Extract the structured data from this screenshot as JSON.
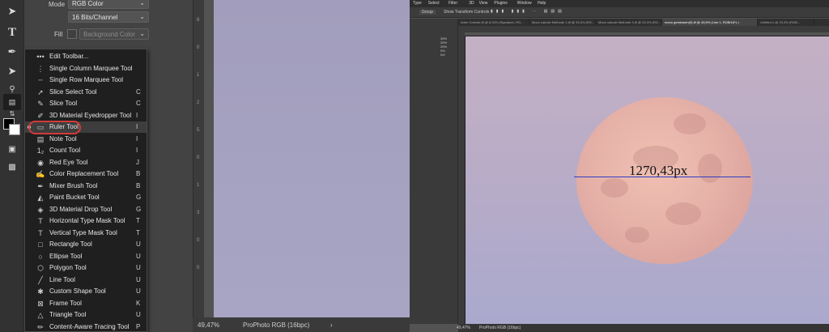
{
  "left": {
    "options": {
      "mode_label": "Mode",
      "mode_value": "RGB Color",
      "bits_value": "16 Bits/Channel",
      "fill_label": "Fill",
      "fill_value": "Background Color"
    },
    "tool_flyout": {
      "items": [
        {
          "label": "Edit Toolbar...",
          "key": "",
          "icon": "dots-icon"
        },
        {
          "label": "Single Column Marquee Tool",
          "key": "",
          "icon": "single-column-marquee-icon"
        },
        {
          "label": "Single Row Marquee Tool",
          "key": "",
          "icon": "single-row-marquee-icon"
        },
        {
          "label": "Slice Select Tool",
          "key": "C",
          "icon": "slice-select-icon"
        },
        {
          "label": "Slice Tool",
          "key": "C",
          "icon": "slice-icon"
        },
        {
          "label": "3D Material Eyedropper Tool",
          "key": "I",
          "icon": "eyedropper-icon"
        },
        {
          "label": "Ruler Tool",
          "key": "I",
          "icon": "ruler-icon"
        },
        {
          "label": "Note Tool",
          "key": "I",
          "icon": "note-icon"
        },
        {
          "label": "Count Tool",
          "key": "I",
          "icon": "count-icon"
        },
        {
          "label": "Red Eye Tool",
          "key": "J",
          "icon": "red-eye-icon"
        },
        {
          "label": "Color Replacement Tool",
          "key": "B",
          "icon": "color-replacement-icon"
        },
        {
          "label": "Mixer Brush Tool",
          "key": "B",
          "icon": "mixer-brush-icon"
        },
        {
          "label": "Paint Bucket Tool",
          "key": "G",
          "icon": "paint-bucket-icon"
        },
        {
          "label": "3D Material Drop Tool",
          "key": "G",
          "icon": "material-drop-icon"
        },
        {
          "label": "Horizontal Type Mask Tool",
          "key": "T",
          "icon": "horizontal-type-mask-icon"
        },
        {
          "label": "Vertical Type Mask Tool",
          "key": "T",
          "icon": "vertical-type-mask-icon"
        },
        {
          "label": "Rectangle Tool",
          "key": "U",
          "icon": "rectangle-icon"
        },
        {
          "label": "Ellipse Tool",
          "key": "U",
          "icon": "ellipse-icon"
        },
        {
          "label": "Polygon Tool",
          "key": "U",
          "icon": "polygon-icon"
        },
        {
          "label": "Line Tool",
          "key": "U",
          "icon": "line-icon"
        },
        {
          "label": "Custom Shape Tool",
          "key": "U",
          "icon": "custom-shape-icon"
        },
        {
          "label": "Frame Tool",
          "key": "K",
          "icon": "frame-icon"
        },
        {
          "label": "Triangle Tool",
          "key": "U",
          "icon": "triangle-icon"
        },
        {
          "label": "Content-Aware Tracing Tool",
          "key": "P",
          "icon": "content-aware-tracing-icon"
        }
      ],
      "highlighted_item": "Ruler Tool"
    },
    "ruler_numbers": [
      "8",
      "0",
      "1",
      "2",
      "5",
      "0",
      "1",
      "3",
      "0",
      "0"
    ],
    "status": {
      "zoom": "49,47%",
      "profile": "ProPhoto RGB (16bpc)",
      "arrow": "›"
    },
    "colors": {
      "highlight_circle": "#d23a3a",
      "canvas": "#a4a0bf"
    }
  },
  "right": {
    "menu": [
      "Type",
      "Select",
      "Filter",
      "3D",
      "View",
      "Plugins",
      "Window",
      "Help"
    ],
    "options_bar": {
      "dropdown": "Group",
      "checkbox_label": "Show Transform Controls"
    },
    "tabs": [
      "Arlen Colerde,tif @ 6,33% (Signature, RG...",
      "Moon calcule Methode 1,tif @ 33,3% (RG...",
      "Moon calcule Methode 3,tif @ 33,3% (RG...",
      "moon gemessen(9).tif @ 49,5% (Line 1, RGB/16*) ×",
      "Untitled-1 @ 33,3% (RGB..."
    ],
    "active_tab_index": 3,
    "panel_values": [
      "35%",
      "29%",
      "25%",
      "0%",
      "0/4"
    ],
    "measurement_label": "1270,43px",
    "status": {
      "zoom": "49,47%",
      "profile": "ProPhoto RGB (16bpc)"
    },
    "colors": {
      "measure_line": "#2c3cc8",
      "moon": "#e6b2a8"
    }
  }
}
